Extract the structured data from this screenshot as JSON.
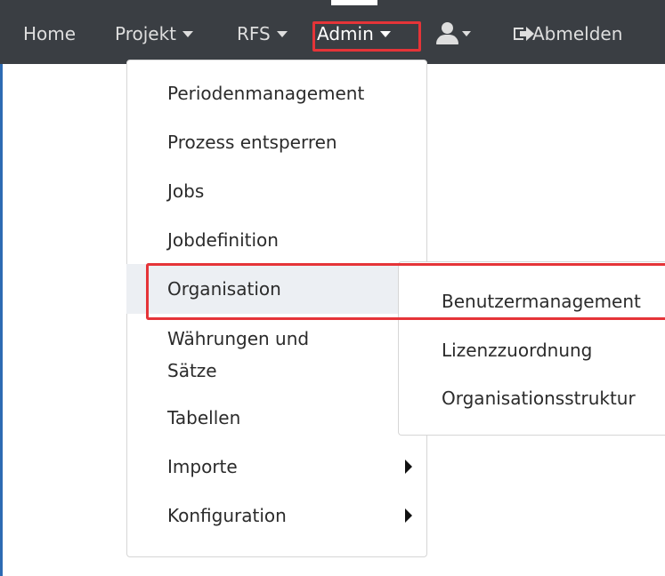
{
  "navbar": {
    "home_label": "Home",
    "projekt_label": "Projekt",
    "rfs_label": "RFS",
    "admin_label": "Admin",
    "logout_label": "Abmelden",
    "user_icon": "user-icon",
    "logout_icon": "sign-out-icon"
  },
  "admin_menu": {
    "items": [
      {
        "label": "Periodenmanagement"
      },
      {
        "label": "Prozess entsperren"
      },
      {
        "label": "Jobs"
      },
      {
        "label": "Jobdefinition"
      },
      {
        "label": "Organisation"
      },
      {
        "label": "Währungen und Sätze"
      },
      {
        "label": "Tabellen"
      },
      {
        "label": "Importe"
      },
      {
        "label": "Konfiguration"
      }
    ]
  },
  "organisation_submenu": {
    "items": [
      {
        "label": "Benutzermanagement"
      },
      {
        "label": "Lizenzzuordnung"
      },
      {
        "label": "Organisationsstruktur"
      }
    ]
  },
  "colors": {
    "navbar_background": "#3a3e43",
    "highlight_red": "#e53438",
    "selected_row": "#eceff3",
    "left_accent": "#2d6bb3"
  }
}
